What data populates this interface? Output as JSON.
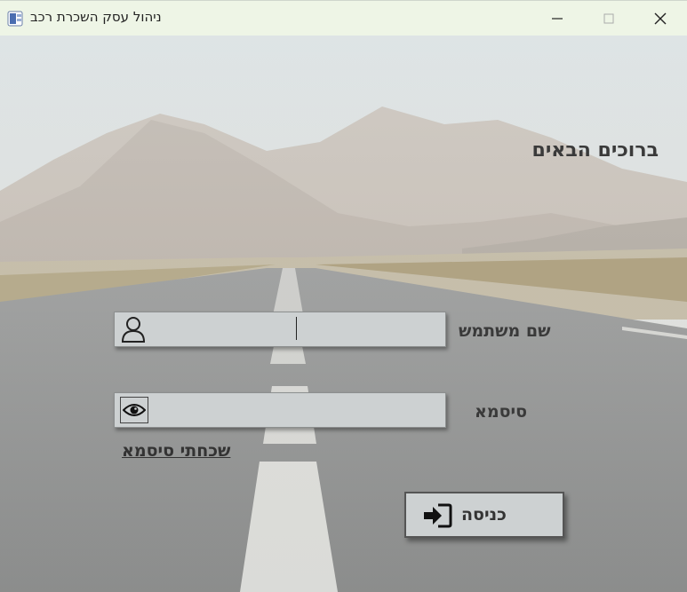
{
  "window": {
    "title": "ניהול עסק השכרת רכב",
    "app_icon": "app-icon",
    "controls": [
      "minimize-icon",
      "maximize-icon",
      "close-icon"
    ]
  },
  "form": {
    "welcome": "ברוכים הבאים",
    "username": {
      "label": "שם משתמש",
      "value": "",
      "icon": "user-icon"
    },
    "password": {
      "label": "סיסמא",
      "value": "",
      "icon": "eye-icon"
    },
    "forgot_password": "שכחתי סיסמא",
    "login_button": {
      "label": "כניסה",
      "icon": "sign-in-icon"
    }
  },
  "background": {
    "scene": "mountain-road",
    "accent_colors": {
      "field_bg": "#cdd1d2",
      "titlebar_bg": "#eef5e6",
      "text": "#3a3a3a"
    }
  }
}
